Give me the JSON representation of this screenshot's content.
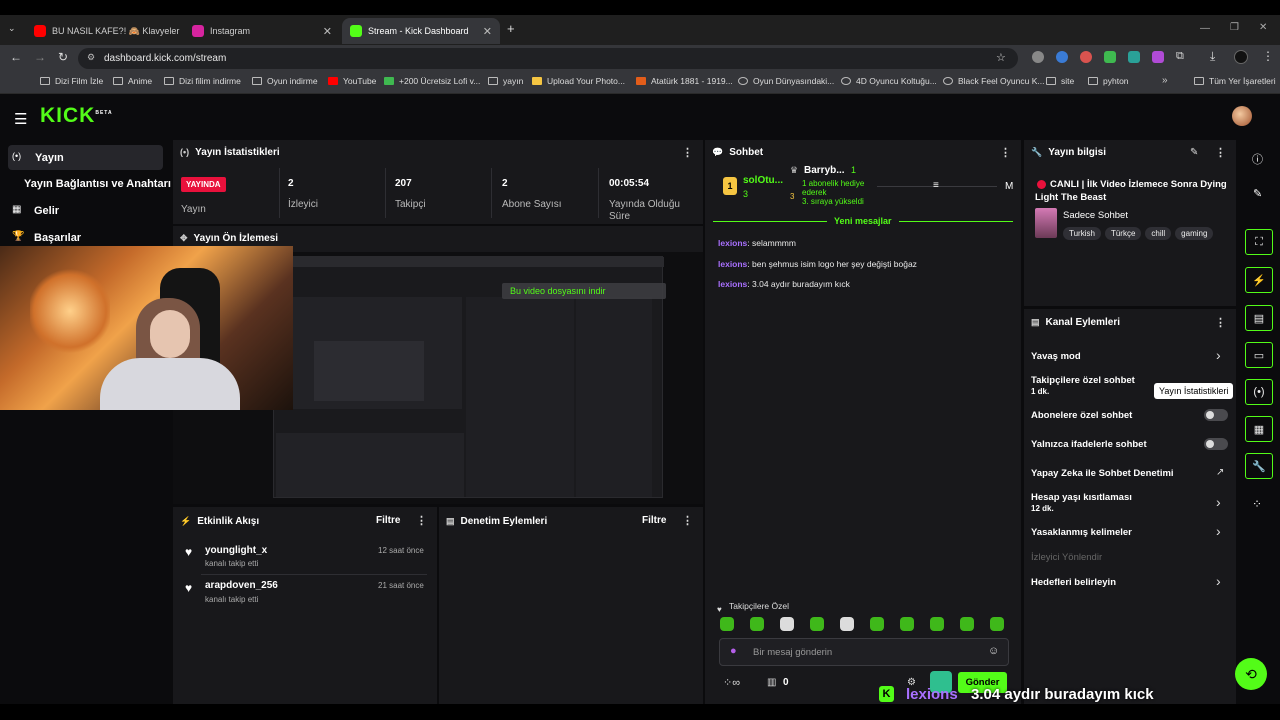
{
  "browser": {
    "tabs": [
      {
        "label": "BU NASIL KAFE?! 🙈 Klavyeler"
      },
      {
        "label": "Instagram"
      },
      {
        "label": "Stream - Kick Dashboard"
      }
    ],
    "url": "dashboard.kick.com/stream",
    "bookmarks": [
      "Dizi Film İzle",
      "Anime",
      "Dizi filim indirme",
      "Oyun indirme",
      "YouTube",
      "+200 Ücretsiz Lofi v...",
      "yayın",
      "Upload Your Photo...",
      "Atatürk 1881 - 1919...",
      "Oyun Dünyasındaki...",
      "4D Oyuncu Koltuğu...",
      "Black Feel Oyuncu K...",
      "site",
      "pyhton",
      "Tüm Yer İşaretleri"
    ]
  },
  "app": {
    "logo": "KICK",
    "logo_beta": "BETA"
  },
  "nav": {
    "items": [
      "Yayın",
      "Yayın Bağlantısı ve Anahtarı",
      "Gelir",
      "Başarılar"
    ]
  },
  "stats": {
    "title": "Yayın İstatistikleri",
    "live_badge": "YAYINDA",
    "live_label": "Yayın",
    "items": [
      {
        "value": "2",
        "label": "İzleyici"
      },
      {
        "value": "207",
        "label": "Takipçi"
      },
      {
        "value": "2",
        "label": "Abone Sayısı"
      },
      {
        "value": "00:05:54",
        "label": "Yayında Olduğu Süre"
      }
    ]
  },
  "preview": {
    "title": "Yayın Ön İzlemesi",
    "download_hint": "Bu video dosyasını indir"
  },
  "activity": {
    "title": "Etkinlik Akışı",
    "filter": "Filtre",
    "events": [
      {
        "user": "younglight_x",
        "action": "kanalı takip etti",
        "time": "12 saat önce"
      },
      {
        "user": "arapdoven_256",
        "action": "kanalı takip etti",
        "time": "21 saat önce"
      }
    ]
  },
  "moderation": {
    "title": "Denetim Eylemleri",
    "filter": "Filtre"
  },
  "chat": {
    "title": "Sohbet",
    "leader1": "solOtu...",
    "leader1_count": "3",
    "leader2": "Barryb...",
    "leader2_count": "1",
    "gift_text": "1 abonelik hediye ederek",
    "gift_rank": "3. sıraya yükseldi",
    "rank_badge": "1",
    "rank_badge2": "3",
    "mode_letter": "M",
    "new_messages": "Yeni mesajlar",
    "messages": [
      {
        "user": "lexions",
        "text": "selammmm"
      },
      {
        "user": "lexions",
        "text": "ben şehmus isim logo her şey değişti boğaz"
      },
      {
        "user": "lexions",
        "text": "3.04 aydır buradayım kıck"
      }
    ],
    "followers_only": "Takipçilere Özel",
    "placeholder": "Bir mesaj gönderin",
    "send": "Gönder",
    "points": "0"
  },
  "info": {
    "title": "Yayın bilgisi",
    "stream_title": "CANLI | İlk Video İzlemece Sonra Dying Light The Beast",
    "category": "Sadece Sohbet",
    "tags": [
      "Turkish",
      "Türkçe",
      "chill",
      "gaming"
    ]
  },
  "actions": {
    "title": "Kanal Eylemleri",
    "items": [
      {
        "label": "Yavaş mod"
      },
      {
        "label": "Takipçilere özel sohbet",
        "sub": "1 dk."
      },
      {
        "label": "Abonelere özel sohbet"
      },
      {
        "label": "Yalnızca ifadelerle sohbet"
      },
      {
        "label": "Yapay Zeka ile Sohbet Denetimi"
      },
      {
        "label": "Hesap yaşı kısıtlaması",
        "sub": "12 dk."
      },
      {
        "label": "Yasaklanmış kelimeler"
      },
      {
        "label": "İzleyici Yönlendir"
      },
      {
        "label": "Hedefleri belirleyin"
      }
    ],
    "tooltip": "Yayın İstatistikleri"
  },
  "overlay": {
    "user": "lexions",
    "text": "3.04 aydır buradayım kıck"
  },
  "colors": {
    "accent": "#53fc18",
    "panel": "#18181b",
    "bg": "#0b0b0d",
    "live": "#e9113c",
    "username": "#a970ff"
  }
}
